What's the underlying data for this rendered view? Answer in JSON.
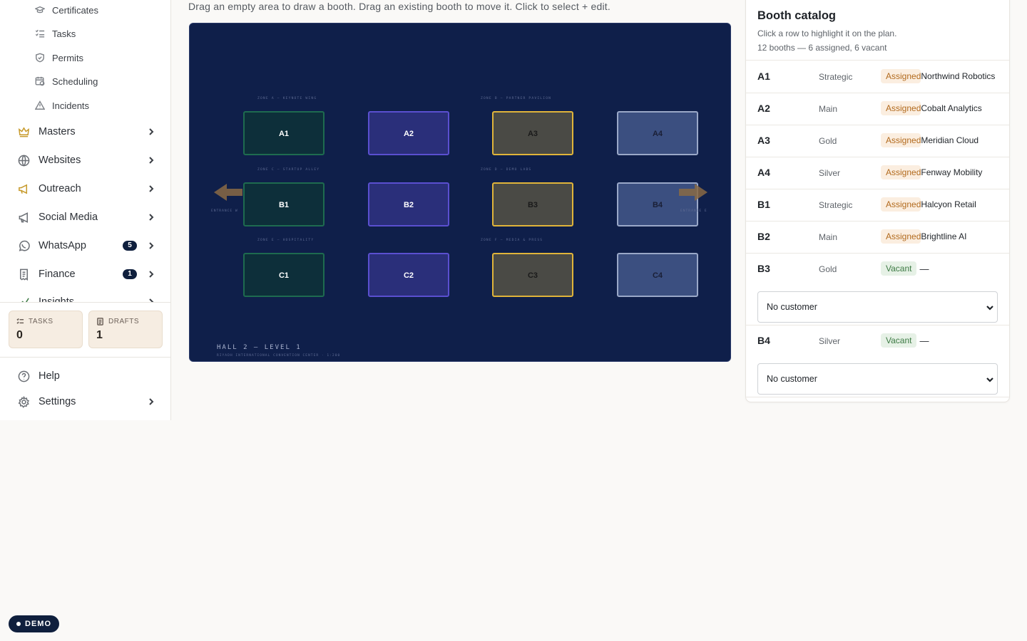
{
  "sidebar": {
    "sub_items": [
      {
        "label": "Certificates",
        "icon": "graduation-cap-icon"
      },
      {
        "label": "Tasks",
        "icon": "list-checks-icon"
      },
      {
        "label": "Permits",
        "icon": "shield-check-icon"
      },
      {
        "label": "Scheduling",
        "icon": "calendar-clock-icon"
      },
      {
        "label": "Incidents",
        "icon": "alert-triangle-icon"
      }
    ],
    "items": [
      {
        "label": "Masters",
        "icon": "crown-icon",
        "badge": ""
      },
      {
        "label": "Websites",
        "icon": "globe-icon",
        "badge": ""
      },
      {
        "label": "Outreach",
        "icon": "megaphone-icon",
        "badge": ""
      },
      {
        "label": "Social Media",
        "icon": "megaphone-outline-icon",
        "badge": ""
      },
      {
        "label": "WhatsApp",
        "icon": "whatsapp-icon",
        "badge": "5"
      },
      {
        "label": "Finance",
        "icon": "receipt-icon",
        "badge": "1"
      },
      {
        "label": "Insights",
        "icon": "chart-icon",
        "badge": ""
      }
    ],
    "stats": {
      "tasks_label": "TASKS",
      "tasks_value": "0",
      "drafts_label": "DRAFTS",
      "drafts_value": "1"
    },
    "footer": [
      {
        "label": "Help",
        "icon": "help-circle-icon"
      },
      {
        "label": "Settings",
        "icon": "settings-icon"
      }
    ],
    "demo_label": "DEMO"
  },
  "main": {
    "hint": "Drag an empty area to draw a booth. Drag an existing booth to move it. Click to select + edit."
  },
  "floorplan": {
    "zones": [
      "ZONE A — KEYNOTE WING",
      "ZONE B — PARTNER PAVILION",
      "ZONE C — STARTUP ALLEY",
      "ZONE D — DEMO LABS",
      "ZONE E — HOSPITALITY",
      "ZONE F — MEDIA & PRESS"
    ],
    "entrance_w": "ENTRANCE W",
    "entrance_e": "ENTRANCE E",
    "hall_title": "HALL 2 — LEVEL 1",
    "hall_subtitle": "RIYADH INTERNATIONAL CONVENTION CENTER · 1:200",
    "booth_colors": {
      "strategic": {
        "fill": "#0d2f3a",
        "stroke": "#1e6b4f",
        "text": "#ffffff"
      },
      "main": {
        "fill": "#2a2f7a",
        "stroke": "#5a4fd0",
        "text": "#ffffff"
      },
      "gold": {
        "fill": "#4a4a45",
        "stroke": "#e0b43a",
        "text": "#1a1a1a"
      },
      "silver": {
        "fill": "#3b4f80",
        "stroke": "#9aa8c8",
        "text": "#1a1f35"
      }
    },
    "booths": [
      {
        "code": "A1",
        "tier": "strategic"
      },
      {
        "code": "A2",
        "tier": "main"
      },
      {
        "code": "A3",
        "tier": "gold"
      },
      {
        "code": "A4",
        "tier": "silver"
      },
      {
        "code": "B1",
        "tier": "strategic"
      },
      {
        "code": "B2",
        "tier": "main"
      },
      {
        "code": "B3",
        "tier": "gold"
      },
      {
        "code": "B4",
        "tier": "silver"
      },
      {
        "code": "C1",
        "tier": "strategic"
      },
      {
        "code": "C2",
        "tier": "main"
      },
      {
        "code": "C3",
        "tier": "gold"
      },
      {
        "code": "C4",
        "tier": "silver"
      }
    ]
  },
  "catalog": {
    "title": "Booth catalog",
    "subtitle": "Click a row to highlight it on the plan.",
    "count": "12 booths — 6 assigned, 6 vacant",
    "select_placeholder": "No customer",
    "rows": [
      {
        "code": "A1",
        "tier": "Strategic",
        "status": "Assigned",
        "customer": "Northwind Robotics"
      },
      {
        "code": "A2",
        "tier": "Main",
        "status": "Assigned",
        "customer": "Cobalt Analytics"
      },
      {
        "code": "A3",
        "tier": "Gold",
        "status": "Assigned",
        "customer": "Meridian Cloud"
      },
      {
        "code": "A4",
        "tier": "Silver",
        "status": "Assigned",
        "customer": "Fenway Mobility"
      },
      {
        "code": "B1",
        "tier": "Strategic",
        "status": "Assigned",
        "customer": "Halcyon Retail"
      },
      {
        "code": "B2",
        "tier": "Main",
        "status": "Assigned",
        "customer": "Brightline AI"
      },
      {
        "code": "B3",
        "tier": "Gold",
        "status": "Vacant",
        "customer": "—"
      },
      {
        "code": "B4",
        "tier": "Silver",
        "status": "Vacant",
        "customer": "—"
      }
    ]
  }
}
